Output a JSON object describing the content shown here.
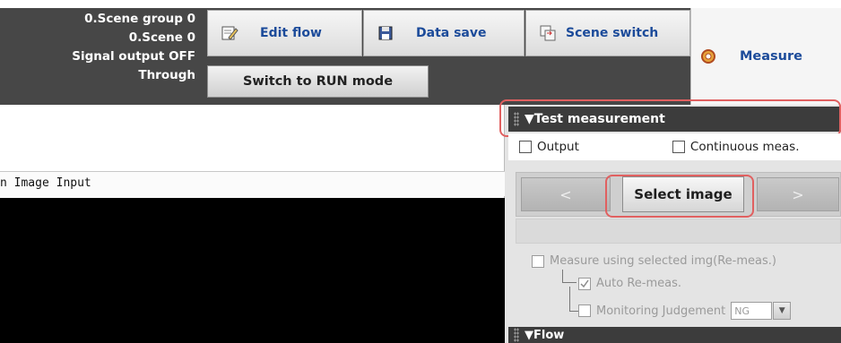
{
  "status": {
    "scene_group": "0.Scene group 0",
    "scene": "0.Scene 0",
    "signal_output": "Signal output OFF",
    "through": "Through"
  },
  "toolbar": {
    "edit_flow": "Edit flow",
    "data_save": "Data save",
    "scene_switch": "Scene switch",
    "measure": "Measure",
    "switch_run": "Switch to RUN mode"
  },
  "image_panel": {
    "title": "n Image Input"
  },
  "test_measurement": {
    "header": "▼Test measurement",
    "output_label": "Output",
    "continuous_label": "Continuous meas.",
    "prev_button": "<",
    "select_image_button": "Select image",
    "next_button": ">",
    "remeasure_label": "Measure using selected img(Re-meas.)",
    "auto_remeas_label": "Auto Re-meas.",
    "monitoring_label": "Monitoring Judgement",
    "monitoring_value": "NG"
  },
  "flow": {
    "header": "▼Flow"
  },
  "colors": {
    "header_bg": "#474747",
    "accent_text": "#1c4b9a",
    "highlight": "#e06060"
  }
}
